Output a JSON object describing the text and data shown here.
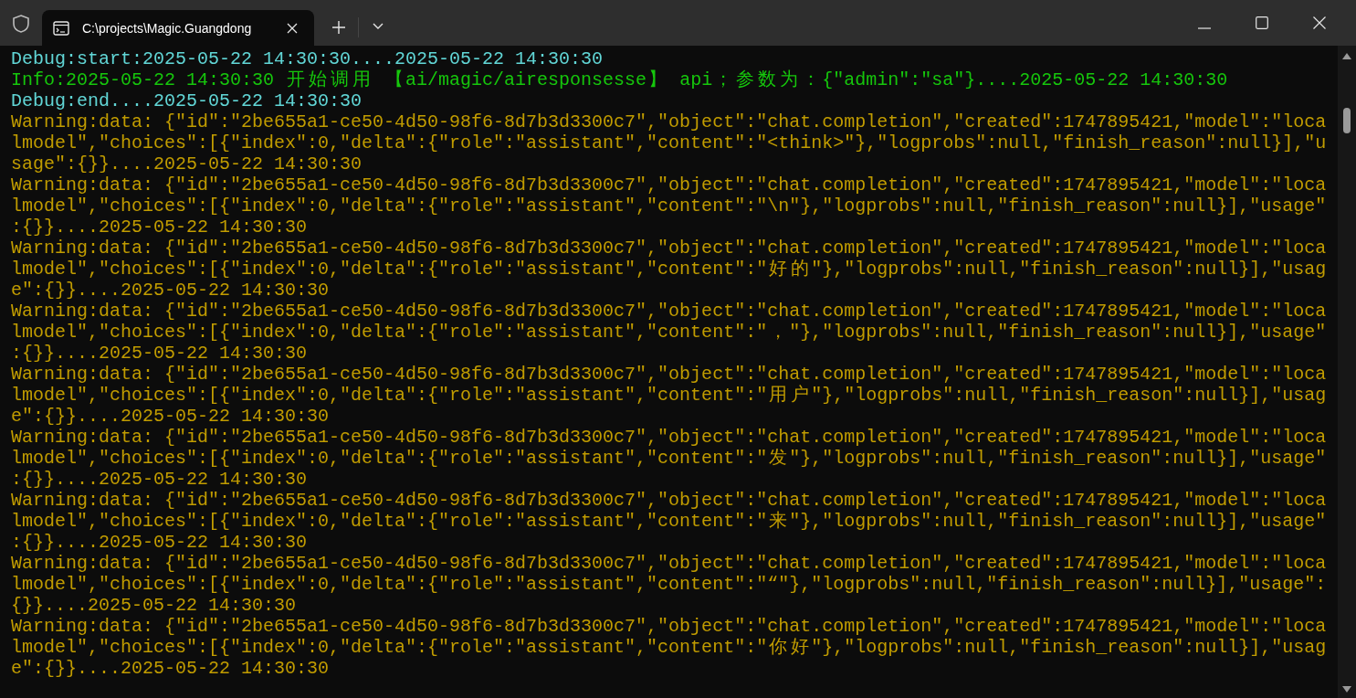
{
  "window": {
    "tab_title": "C:\\projects\\Magic.Guangdong"
  },
  "log": [
    {
      "kind": "debug",
      "text": "Debug:start:2025-05-22 14:30:30....2025-05-22 14:30:30"
    },
    {
      "kind": "info",
      "text": "Info:2025-05-22 14:30:30 开始调用 【ai/magic/airesponsesse】 api；参数为：{\"admin\":\"sa\"}....2025-05-22 14:30:30"
    },
    {
      "kind": "debug",
      "text": "Debug:end....2025-05-22 14:30:30"
    },
    {
      "kind": "warning",
      "text": "Warning:data: {\"id\":\"2be655a1-ce50-4d50-98f6-8d7b3d3300c7\",\"object\":\"chat.completion\",\"created\":1747895421,\"model\":\"localmodel\",\"choices\":[{\"index\":0,\"delta\":{\"role\":\"assistant\",\"content\":\"<think>\"},\"logprobs\":null,\"finish_reason\":null}],\"usage\":{}}....2025-05-22 14:30:30"
    },
    {
      "kind": "warning",
      "text": "Warning:data: {\"id\":\"2be655a1-ce50-4d50-98f6-8d7b3d3300c7\",\"object\":\"chat.completion\",\"created\":1747895421,\"model\":\"localmodel\",\"choices\":[{\"index\":0,\"delta\":{\"role\":\"assistant\",\"content\":\"\\n\"},\"logprobs\":null,\"finish_reason\":null}],\"usage\":{}}....2025-05-22 14:30:30"
    },
    {
      "kind": "warning",
      "text": "Warning:data: {\"id\":\"2be655a1-ce50-4d50-98f6-8d7b3d3300c7\",\"object\":\"chat.completion\",\"created\":1747895421,\"model\":\"localmodel\",\"choices\":[{\"index\":0,\"delta\":{\"role\":\"assistant\",\"content\":\"好的\"},\"logprobs\":null,\"finish_reason\":null}],\"usage\":{}}....2025-05-22 14:30:30"
    },
    {
      "kind": "warning",
      "text": "Warning:data: {\"id\":\"2be655a1-ce50-4d50-98f6-8d7b3d3300c7\",\"object\":\"chat.completion\",\"created\":1747895421,\"model\":\"localmodel\",\"choices\":[{\"index\":0,\"delta\":{\"role\":\"assistant\",\"content\":\"，\"},\"logprobs\":null,\"finish_reason\":null}],\"usage\":{}}....2025-05-22 14:30:30"
    },
    {
      "kind": "warning",
      "text": "Warning:data: {\"id\":\"2be655a1-ce50-4d50-98f6-8d7b3d3300c7\",\"object\":\"chat.completion\",\"created\":1747895421,\"model\":\"localmodel\",\"choices\":[{\"index\":0,\"delta\":{\"role\":\"assistant\",\"content\":\"用户\"},\"logprobs\":null,\"finish_reason\":null}],\"usage\":{}}....2025-05-22 14:30:30"
    },
    {
      "kind": "warning",
      "text": "Warning:data: {\"id\":\"2be655a1-ce50-4d50-98f6-8d7b3d3300c7\",\"object\":\"chat.completion\",\"created\":1747895421,\"model\":\"localmodel\",\"choices\":[{\"index\":0,\"delta\":{\"role\":\"assistant\",\"content\":\"发\"},\"logprobs\":null,\"finish_reason\":null}],\"usage\":{}}....2025-05-22 14:30:30"
    },
    {
      "kind": "warning",
      "text": "Warning:data: {\"id\":\"2be655a1-ce50-4d50-98f6-8d7b3d3300c7\",\"object\":\"chat.completion\",\"created\":1747895421,\"model\":\"localmodel\",\"choices\":[{\"index\":0,\"delta\":{\"role\":\"assistant\",\"content\":\"来\"},\"logprobs\":null,\"finish_reason\":null}],\"usage\":{}}....2025-05-22 14:30:30"
    },
    {
      "kind": "warning",
      "text": "Warning:data: {\"id\":\"2be655a1-ce50-4d50-98f6-8d7b3d3300c7\",\"object\":\"chat.completion\",\"created\":1747895421,\"model\":\"localmodel\",\"choices\":[{\"index\":0,\"delta\":{\"role\":\"assistant\",\"content\":\"“\"},\"logprobs\":null,\"finish_reason\":null}],\"usage\":{}}....2025-05-22 14:30:30"
    },
    {
      "kind": "warning",
      "text": "Warning:data: {\"id\":\"2be655a1-ce50-4d50-98f6-8d7b3d3300c7\",\"object\":\"chat.completion\",\"created\":1747895421,\"model\":\"localmodel\",\"choices\":[{\"index\":0,\"delta\":{\"role\":\"assistant\",\"content\":\"你好\"},\"logprobs\":null,\"finish_reason\":null}],\"usage\":{}}....2025-05-22 14:30:30"
    }
  ]
}
